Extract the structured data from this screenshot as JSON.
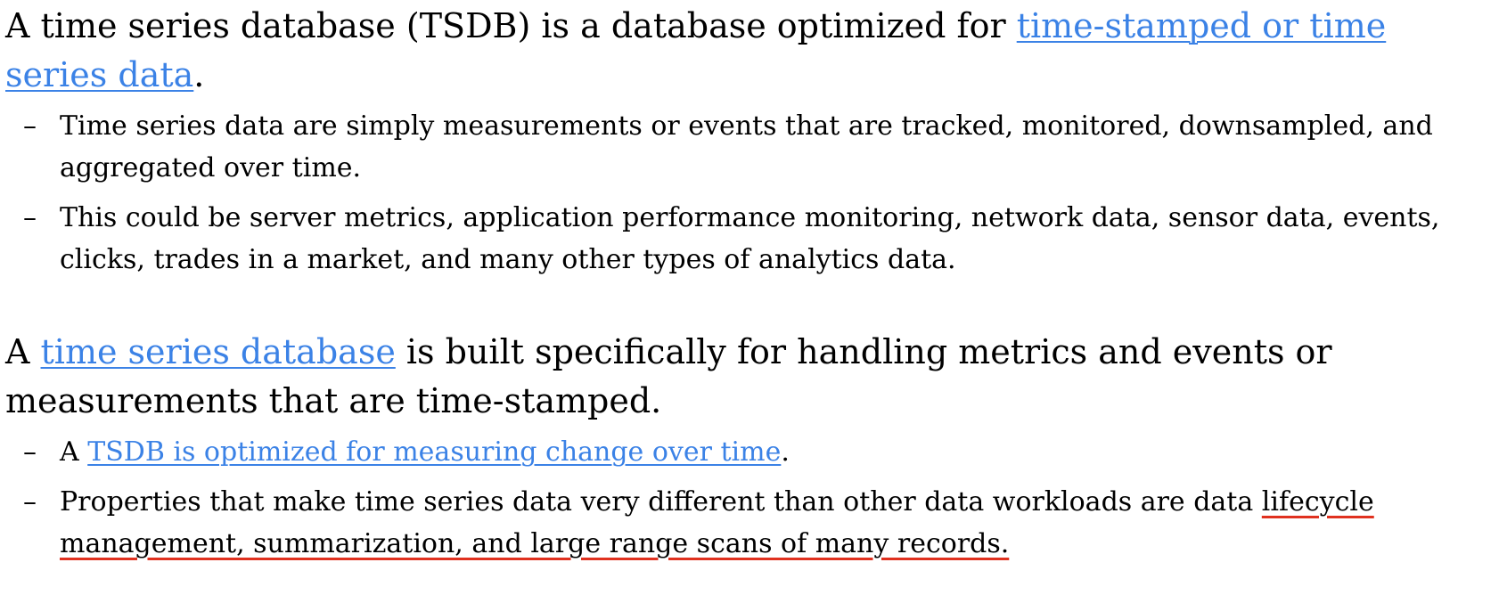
{
  "document": {
    "para1": {
      "text_before": "A time series database (TSDB) is a database optimized for ",
      "link": "time-stamped or time series data",
      "text_after": "."
    },
    "bullets1": [
      "Time series data are simply measurements or events that are tracked, monitored, downsampled, and aggregated over time.",
      "This could be server metrics, application performance monitoring, network data, sensor data, events, clicks, trades in a market, and many other types of analytics data."
    ],
    "para2": {
      "text_before": "A ",
      "link": "time series database",
      "text_after": " is built specifically for handling metrics and events or measurements that are time-stamped."
    },
    "bullets2": {
      "item1": {
        "text_before": "A ",
        "link": "TSDB is optimized for measuring change over time",
        "text_after": "."
      },
      "item2": {
        "text_before": "Properties that make time series data very different than other data workloads are data ",
        "underlined": "lifecycle management, summarization, and large range scans of many records."
      }
    },
    "dash": "–"
  },
  "colors": {
    "link": "#3b82e6",
    "spellcheck_underline": "#e0311f",
    "text": "#000000",
    "background": "#ffffff"
  }
}
